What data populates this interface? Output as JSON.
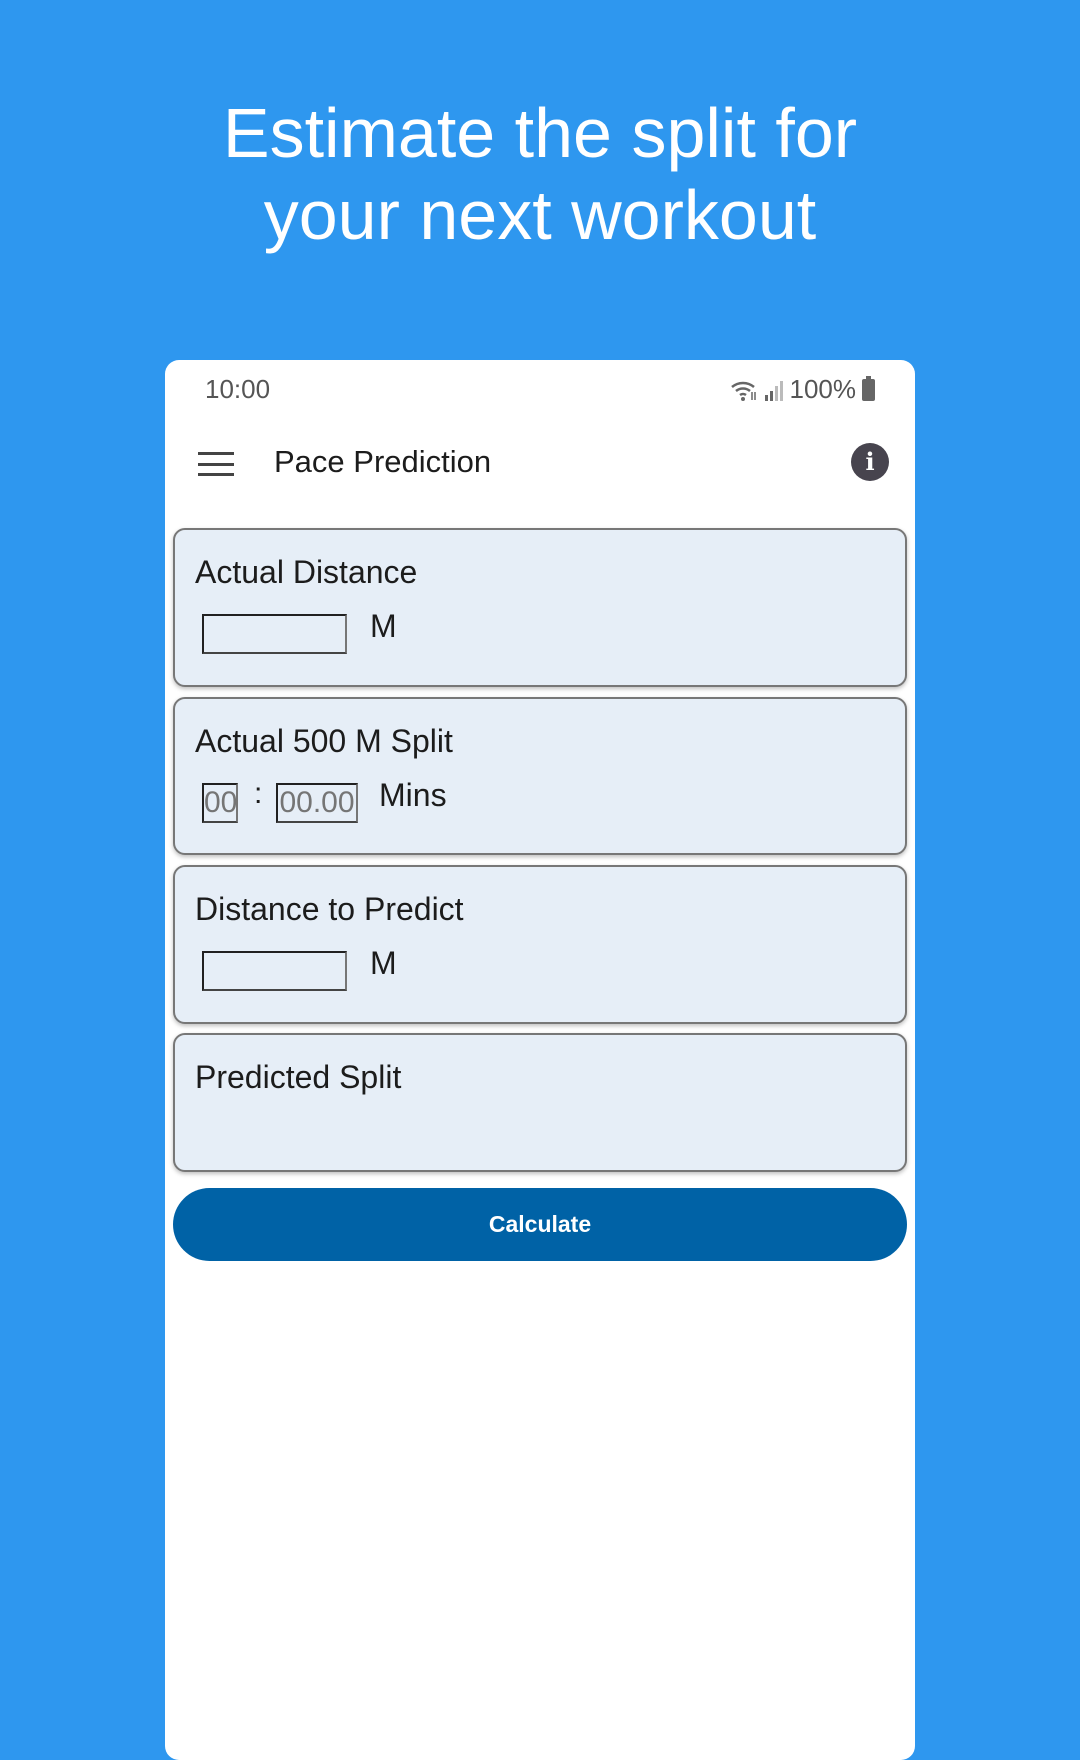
{
  "headline": {
    "line1": "Estimate the split for",
    "line2": "your next workout"
  },
  "status_bar": {
    "time": "10:00",
    "battery": "100%",
    "icons": [
      "wifi-icon",
      "signal-icon",
      "battery-icon"
    ]
  },
  "toolbar": {
    "title": "Pace Prediction",
    "menu_icon": "hamburger-icon",
    "info_icon": "info-icon"
  },
  "cards": {
    "actual_distance": {
      "label": "Actual Distance",
      "value": "",
      "unit": "M"
    },
    "actual_split": {
      "label": "Actual 500 M Split",
      "minutes_placeholder": "00",
      "separator": ":",
      "seconds_placeholder": "00.00",
      "unit": "Mins"
    },
    "distance_to_predict": {
      "label": "Distance to Predict",
      "value": "",
      "unit": "M"
    },
    "predicted_split": {
      "label": "Predicted Split",
      "value": ""
    }
  },
  "calculate_label": "Calculate",
  "colors": {
    "background": "#2e97ef",
    "card": "#e6eef7",
    "button": "#0062a6"
  }
}
